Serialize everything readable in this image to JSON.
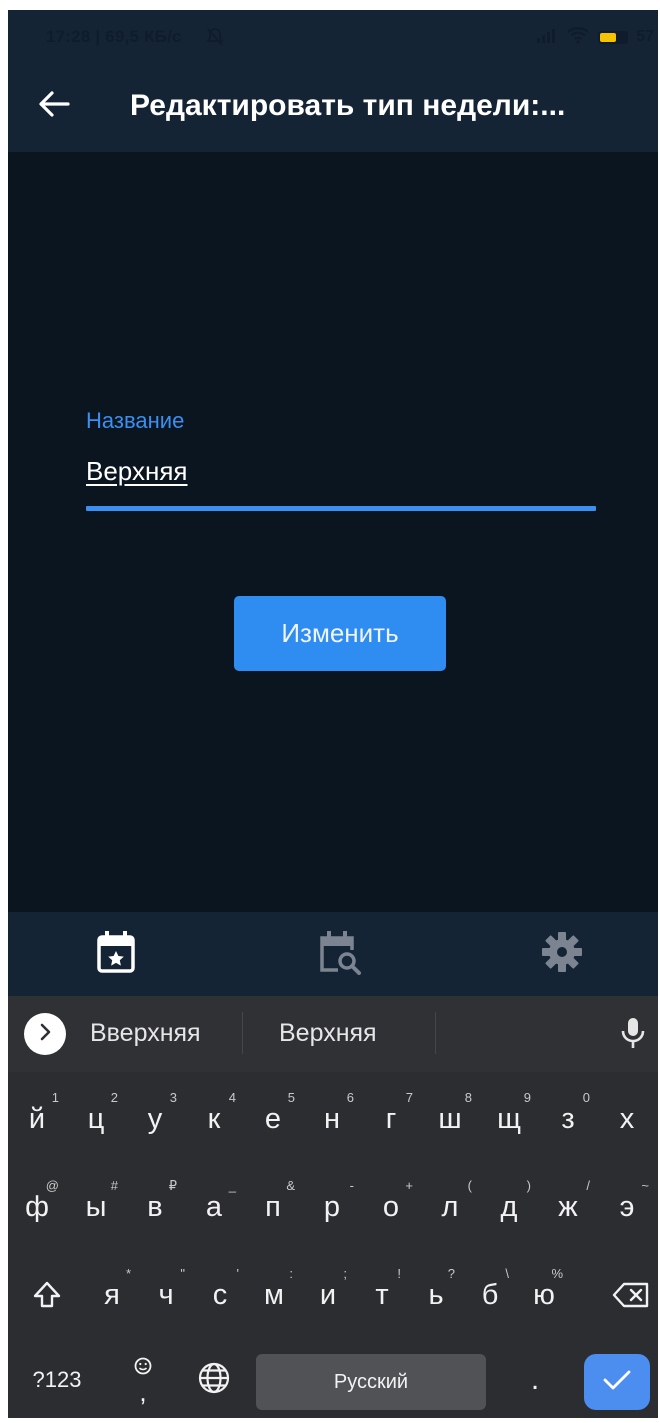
{
  "status_bar": {
    "time": "17:28 | 69,5 КБ/с",
    "battery": "57"
  },
  "app_bar": {
    "title": "Редактировать тип недели:..."
  },
  "form": {
    "label": "Название",
    "value": "Верхняя",
    "submit": "Изменить"
  },
  "bottom_nav": {
    "items": [
      "calendar-star",
      "calendar-search",
      "settings"
    ]
  },
  "keyboard": {
    "suggestions": [
      "Вверхняя",
      "Верхняя"
    ],
    "row1": [
      {
        "k": "й",
        "h": "1"
      },
      {
        "k": "ц",
        "h": "2"
      },
      {
        "k": "у",
        "h": "3"
      },
      {
        "k": "к",
        "h": "4"
      },
      {
        "k": "е",
        "h": "5"
      },
      {
        "k": "н",
        "h": "6"
      },
      {
        "k": "г",
        "h": "7"
      },
      {
        "k": "ш",
        "h": "8"
      },
      {
        "k": "щ",
        "h": "9"
      },
      {
        "k": "з",
        "h": "0"
      },
      {
        "k": "х",
        "h": ""
      }
    ],
    "row2": [
      {
        "k": "ф",
        "h": "@"
      },
      {
        "k": "ы",
        "h": "#"
      },
      {
        "k": "в",
        "h": "₽"
      },
      {
        "k": "а",
        "h": "_"
      },
      {
        "k": "п",
        "h": "&"
      },
      {
        "k": "р",
        "h": "-"
      },
      {
        "k": "о",
        "h": "+"
      },
      {
        "k": "л",
        "h": "("
      },
      {
        "k": "д",
        "h": ")"
      },
      {
        "k": "ж",
        "h": "/"
      },
      {
        "k": "э",
        "h": "~"
      }
    ],
    "row3": [
      {
        "k": "я",
        "h": "*"
      },
      {
        "k": "ч",
        "h": "\""
      },
      {
        "k": "с",
        "h": "'"
      },
      {
        "k": "м",
        "h": ":"
      },
      {
        "k": "и",
        "h": ";"
      },
      {
        "k": "т",
        "h": "!"
      },
      {
        "k": "ь",
        "h": "?"
      },
      {
        "k": "б",
        "h": "\\"
      },
      {
        "k": "ю",
        "h": "%"
      }
    ],
    "symbols": "?123",
    "comma": ",",
    "space": "Русский",
    "period": "."
  },
  "colors": {
    "accent": "#2f8cf0",
    "background": "#0b1520",
    "appbar": "#152435"
  }
}
